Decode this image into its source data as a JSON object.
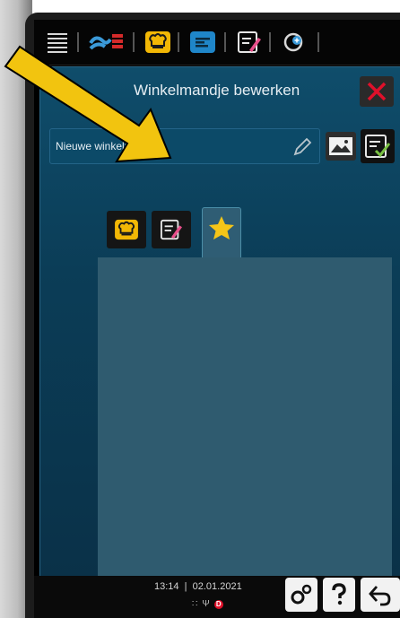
{
  "header": {
    "title": "Winkelmandje bewerken"
  },
  "name_field": {
    "value": "Nieuwe winkelmand"
  },
  "tabs": [
    {
      "name": "cook",
      "icon": "chef-hat-icon"
    },
    {
      "name": "edit",
      "icon": "edit-list-icon"
    },
    {
      "name": "favorites",
      "icon": "star-icon"
    }
  ],
  "status": {
    "time": "13:14",
    "date": "02.01.2021",
    "badge": "D"
  },
  "colors": {
    "accent_yellow": "#f2b705",
    "close_red": "#e0102a",
    "panel_blue": "#0b3d57",
    "content_blue": "#2f5b6f",
    "check_green": "#7ac143"
  }
}
